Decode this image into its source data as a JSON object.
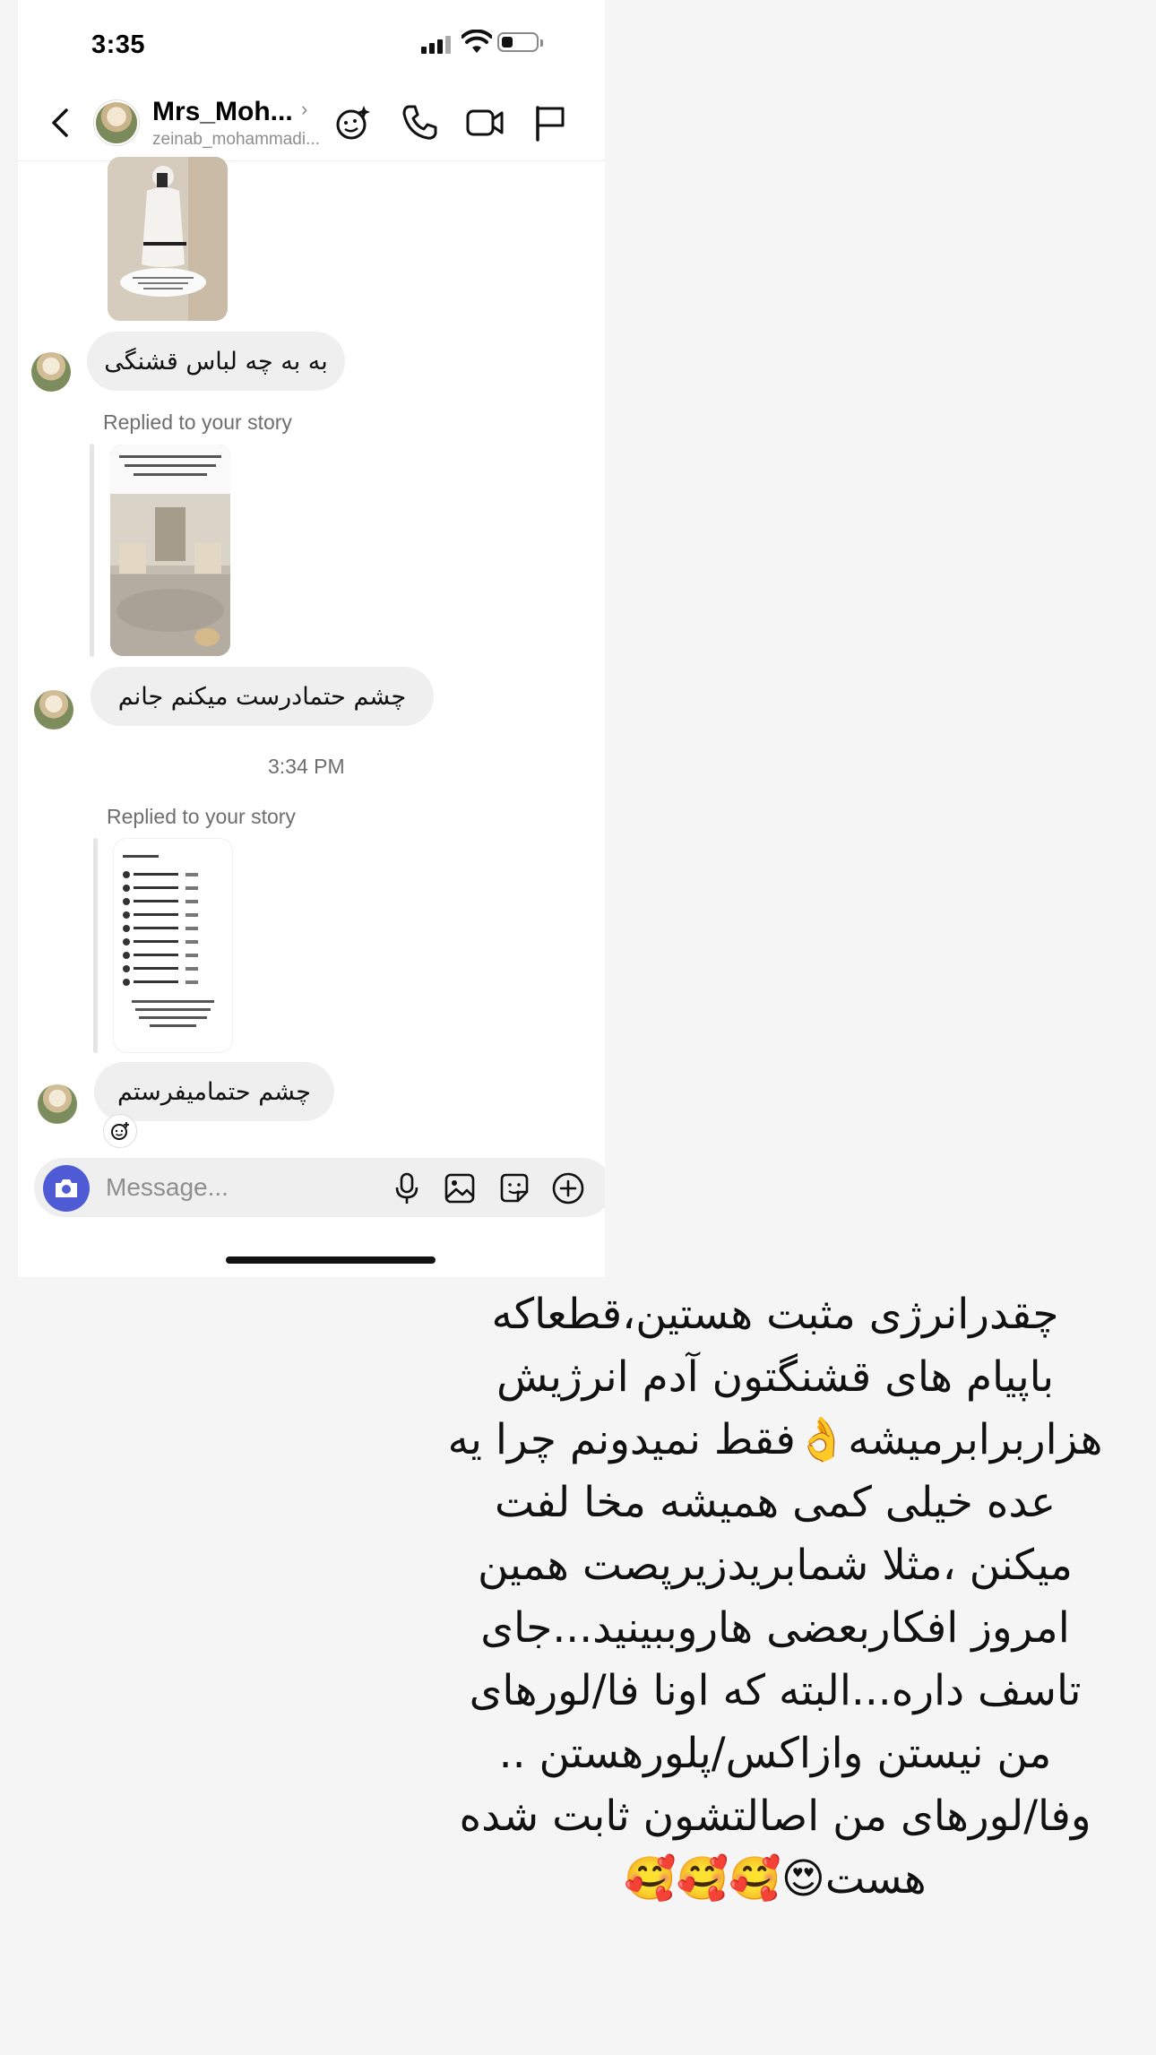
{
  "status_bar": {
    "time": "3:35"
  },
  "header": {
    "display_name": "Mrs_Moh...",
    "username": "zeinab_mohammadi..."
  },
  "messages": [
    {
      "type": "received",
      "text": "به به چه لباس قشنگی"
    },
    {
      "type": "story_reply_label",
      "text": "Replied to your story"
    },
    {
      "type": "received",
      "text": "چشم حتمادرست میکنم جانم"
    },
    {
      "type": "timestamp",
      "text": "3:34 PM"
    },
    {
      "type": "story_reply_label",
      "text": "Replied to your story"
    },
    {
      "type": "received",
      "text": "چشم حتمامیفرستم"
    }
  ],
  "composer": {
    "placeholder": "Message..."
  },
  "caption": {
    "lines": [
      "چقدرانرژی مثبت هستین،قطعاکه",
      "باپیام های قشنگتون آدم انرژیش",
      "هزاربرابرمیشه👌فقط نمیدونم چرا یه",
      "عده خیلی کمی همیشه مخا لفت",
      "میکنن ،مثلا شمابریدزیرپصت همین",
      "امروز افکاربعضی هاروببینید...جای",
      "تاسف داره...البته که اونا فا/لورهای",
      "من نیستن وازاکس/پلورهستن ..",
      "وفا/لورهای من اصالتشون ثابت شده",
      "هست😍🥰🥰🥰"
    ]
  },
  "colors": {
    "camera_button": "#4f5bd5",
    "bubble": "#efefef",
    "page_background": "#f5f5f6"
  },
  "icons": [
    "back-icon",
    "effects-icon",
    "phone-icon",
    "video-icon",
    "flag-icon",
    "camera-icon",
    "microphone-icon",
    "gallery-icon",
    "sticker-icon",
    "plus-icon",
    "reaction-icon"
  ]
}
